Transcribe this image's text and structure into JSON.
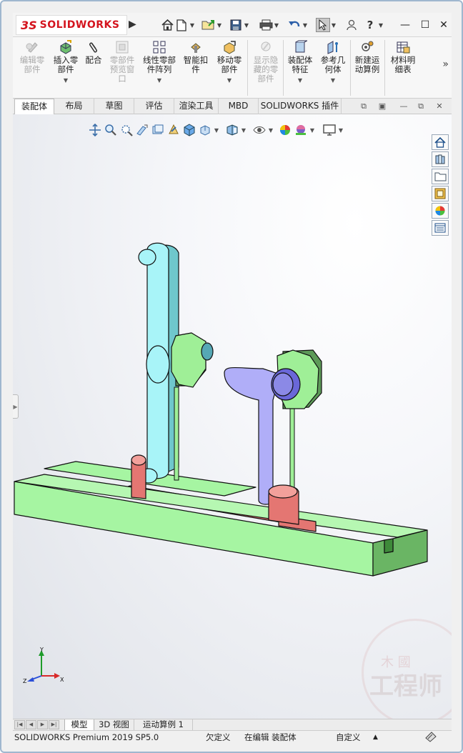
{
  "app": {
    "brand_prefix": "3S",
    "brand_name": "SOLIDWORKS"
  },
  "quick_access": [
    {
      "icon": "home-icon"
    },
    {
      "icon": "new-document-icon"
    },
    {
      "icon": "open-folder-icon"
    },
    {
      "icon": "save-icon"
    },
    {
      "icon": "print-icon"
    },
    {
      "icon": "undo-icon"
    },
    {
      "icon": "select-arrow-icon"
    },
    {
      "icon": "user-icon"
    },
    {
      "icon": "help-icon",
      "glyph": "?"
    }
  ],
  "ribbon": {
    "items": [
      {
        "label": "编辑零\n部件",
        "enabled": false
      },
      {
        "label": "插入零\n部件",
        "enabled": true
      },
      {
        "label": "配合",
        "enabled": true
      },
      {
        "label": "零部件\n预览窗\n口",
        "enabled": false
      },
      {
        "label": "线性零部\n件阵列",
        "enabled": true
      },
      {
        "label": "智能扣\n件",
        "enabled": true
      },
      {
        "label": "移动零\n部件",
        "enabled": true
      },
      {
        "label": "显示隐\n藏的零\n部件",
        "enabled": false
      },
      {
        "label": "装配体\n特征",
        "enabled": true
      },
      {
        "label": "参考几\n何体",
        "enabled": true
      },
      {
        "label": "新建运\n动算例",
        "enabled": true
      },
      {
        "label": "材料明\n细表",
        "enabled": true
      }
    ],
    "more": "»"
  },
  "tabs": [
    {
      "label": "装配体",
      "active": true
    },
    {
      "label": "布局",
      "active": false
    },
    {
      "label": "草图",
      "active": false
    },
    {
      "label": "评估",
      "active": false
    },
    {
      "label": "渲染工具",
      "active": false
    },
    {
      "label": "MBD",
      "active": false
    },
    {
      "label": "SOLIDWORKS 插件",
      "active": false
    }
  ],
  "bottom_tabs": [
    {
      "label": "模型",
      "active": true
    },
    {
      "label": "3D 视图",
      "active": false
    },
    {
      "label": "运动算例 1",
      "active": false
    }
  ],
  "status": {
    "product": "SOLIDWORKS Premium 2019 SP5.0",
    "definition": "欠定义",
    "editing": "在编辑 装配体",
    "units": "自定义",
    "units_arrow": "▲"
  },
  "triad": {
    "x": "X",
    "y": "Y",
    "z": "Z"
  },
  "watermark": {
    "line1": "木  國",
    "line2": "工程师"
  },
  "colors": {
    "base": "#a6f5a2",
    "slider": "#e47672",
    "link_long": "#a8f4f8",
    "link_short": "#b0aef8",
    "hub": "#9fef97",
    "accent_red": "#d4141e"
  }
}
